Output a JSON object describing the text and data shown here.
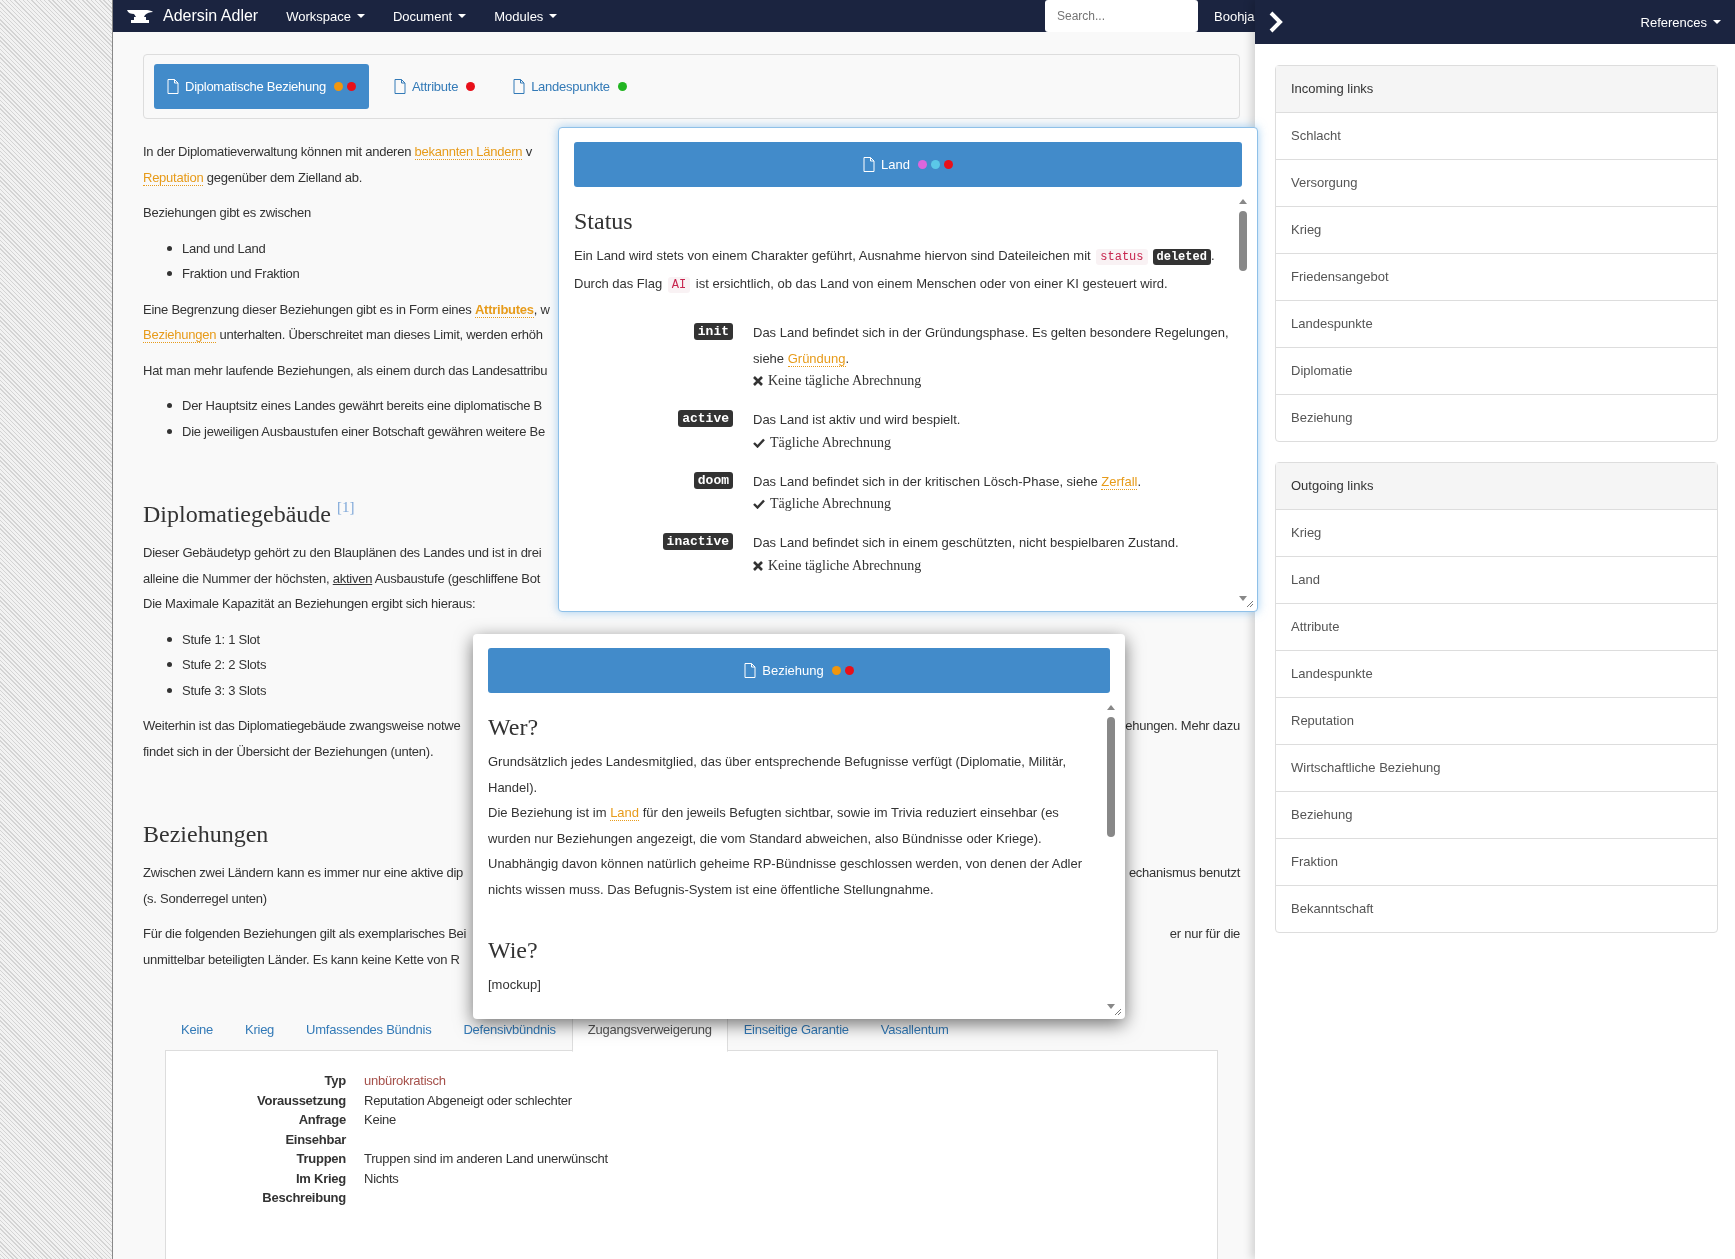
{
  "navbar": {
    "brand": "Adersin Adler",
    "menus": [
      "Workspace",
      "Document",
      "Modules"
    ],
    "search": {
      "placeholder": "Search..."
    },
    "user": "Boohja"
  },
  "doc_tabs": [
    {
      "label": "Diplomatische Beziehung",
      "selected": true,
      "dots": [
        {
          "color": "#f0960e"
        },
        {
          "color": "#e8101a"
        }
      ]
    },
    {
      "label": "Attribute",
      "selected": false,
      "dots": [
        {
          "color": "#e8101a"
        }
      ]
    },
    {
      "label": "Landespunkte",
      "selected": false,
      "dots": [
        {
          "color": "#22b522"
        }
      ]
    }
  ],
  "content": [
    {
      "kind": "paragraph",
      "lines": [
        {
          "segments": [
            {
              "kind": "plain",
              "text": "In der Diplomatieverwaltung können mit anderen "
            },
            {
              "kind": "link",
              "text": "bekannten Ländern"
            },
            {
              "kind": "plain",
              "text": " v"
            }
          ]
        },
        {
          "segments": [
            {
              "kind": "link",
              "text": "Reputation"
            },
            {
              "kind": "plain",
              "text": " gegenüber dem Zielland ab."
            }
          ]
        }
      ]
    },
    {
      "kind": "paragraph",
      "lines": [
        {
          "segments": [
            {
              "kind": "plain",
              "text": "Beziehungen gibt es zwischen"
            }
          ]
        }
      ]
    },
    {
      "kind": "list",
      "items": [
        {
          "segments": [
            {
              "kind": "plain",
              "text": "Land und Land"
            }
          ]
        },
        {
          "segments": [
            {
              "kind": "plain",
              "text": "Fraktion und Fraktion"
            }
          ]
        }
      ]
    },
    {
      "kind": "paragraph",
      "lines": [
        {
          "segments": [
            {
              "kind": "plain",
              "text": "Eine Begrenzung dieser Beziehungen gibt es in Form eines "
            },
            {
              "kind": "strong-link",
              "text": "Attributes"
            },
            {
              "kind": "plain",
              "text": ", w"
            }
          ]
        },
        {
          "segments": [
            {
              "kind": "link",
              "text": "Beziehungen"
            },
            {
              "kind": "plain",
              "text": " unterhalten. Überschreitet man dieses Limit, werden erhöh"
            }
          ]
        }
      ]
    },
    {
      "kind": "paragraph",
      "lines": [
        {
          "segments": [
            {
              "kind": "plain",
              "text": "Hat man mehr laufende Beziehungen, als einem durch das Landesattribu"
            }
          ]
        }
      ]
    },
    {
      "kind": "list",
      "items": [
        {
          "segments": [
            {
              "kind": "plain",
              "text": "Der Hauptsitz eines Landes gewährt bereits eine diplomatische B"
            }
          ]
        },
        {
          "segments": [
            {
              "kind": "plain",
              "text": "Die jeweiligen Ausbaustufen einer Botschaft gewähren weitere Be"
            }
          ]
        }
      ]
    },
    {
      "kind": "heading",
      "text": "Diplomatiegebäude",
      "note": "[1]"
    },
    {
      "kind": "paragraph",
      "lines": [
        {
          "segments": [
            {
              "kind": "plain",
              "text": "Dieser Gebäudetyp gehört zu den Blauplänen des Landes und ist in drei"
            }
          ]
        },
        {
          "segments": [
            {
              "kind": "plain",
              "text": "alleine die Nummer der höchsten, "
            },
            {
              "kind": "underlined",
              "text": "aktiven"
            },
            {
              "kind": "plain",
              "text": " Ausbaustufe (geschliffene Bot"
            }
          ]
        },
        {
          "segments": [
            {
              "kind": "plain",
              "text": "Die Maximale Kapazität an Beziehungen ergibt sich hieraus:"
            }
          ]
        }
      ]
    },
    {
      "kind": "list",
      "items": [
        {
          "segments": [
            {
              "kind": "plain",
              "text": "Stufe 1: 1 Slot"
            }
          ]
        },
        {
          "segments": [
            {
              "kind": "plain",
              "text": "Stufe 2: 2 Slots"
            }
          ]
        },
        {
          "segments": [
            {
              "kind": "plain",
              "text": "Stufe 3: 3 Slots"
            }
          ]
        }
      ]
    },
    {
      "kind": "paragraph",
      "lines": [
        {
          "segments": [
            {
              "kind": "plain",
              "text": "Weiterhin ist das Diplomatiegebäude zwangsweise notwe"
            }
          ],
          "tail": "ehungen. Mehr dazu"
        },
        {
          "segments": [
            {
              "kind": "plain",
              "text": "findet sich in der Übersicht der Beziehungen (unten)."
            }
          ]
        }
      ]
    },
    {
      "kind": "heading",
      "text": "Beziehungen"
    },
    {
      "kind": "paragraph",
      "lines": [
        {
          "segments": [
            {
              "kind": "plain",
              "text": "Zwischen zwei Ländern kann es immer nur eine aktive dip"
            }
          ],
          "tail": "echanismus benutzt"
        },
        {
          "segments": [
            {
              "kind": "plain",
              "text": "(s. Sonderregel unten)"
            }
          ]
        }
      ]
    },
    {
      "kind": "paragraph",
      "lines": [
        {
          "segments": [
            {
              "kind": "plain",
              "text": "Für die folgenden Beziehungen gilt als exemplarisches Bei"
            }
          ],
          "tail": "er nur für die"
        },
        {
          "segments": [
            {
              "kind": "plain",
              "text": "unmittelbar beteiligten Länder. Es kann keine Kette von R"
            }
          ]
        }
      ]
    }
  ],
  "relation_tabs": [
    {
      "label": "Keine",
      "selected": false
    },
    {
      "label": "Krieg",
      "selected": false
    },
    {
      "label": "Umfassendes Bündnis",
      "selected": false
    },
    {
      "label": "Defensivbündnis",
      "selected": false
    },
    {
      "label": "Zugangsverweigerung",
      "selected": true
    },
    {
      "label": "Einseitige Garantie",
      "selected": false
    },
    {
      "label": "Vasallentum",
      "selected": false
    }
  ],
  "details": [
    {
      "label": "Typ",
      "value": "unbürokratisch",
      "kind": "type"
    },
    {
      "label": "Voraussetzung",
      "value": "Reputation Abgeneigt oder schlechter",
      "kind": "plain"
    },
    {
      "label": "Anfrage",
      "value": "Keine",
      "kind": "plain"
    },
    {
      "label": "Einsehbar"
    },
    {
      "label": "Truppen",
      "value": "Truppen sind im anderen Land unerwünscht",
      "kind": "plain"
    },
    {
      "label": "Im Krieg",
      "value": "Nichts",
      "kind": "plain"
    },
    {
      "label": "Beschreibung"
    }
  ],
  "references": {
    "title": "References",
    "panels": [
      {
        "title": "Incoming links",
        "items": [
          "Schlacht",
          "Versorgung",
          "Krieg",
          "Friedensangebot",
          "Landespunkte",
          "Diplomatie",
          "Beziehung"
        ]
      },
      {
        "title": "Outgoing links",
        "items": [
          "Krieg",
          "Land",
          "Attribute",
          "Landespunkte",
          "Reputation",
          "Wirtschaftliche Beziehung",
          "Beziehung",
          "Fraktion",
          "Bekanntschaft"
        ]
      }
    ]
  },
  "popups": [
    {
      "title": "Land",
      "dots": [
        {
          "color": "#dd66dd"
        },
        {
          "color": "#5bc8e8"
        },
        {
          "color": "#e8101a"
        }
      ],
      "body": [
        {
          "kind": "heading",
          "text": "Status"
        },
        {
          "kind": "paragraph",
          "lines": [
            {
              "segments": [
                {
                  "kind": "plain",
                  "text": "Ein Land wird stets von einem Charakter geführt, Ausnahme hiervon sind Dateileichen mit "
                },
                {
                  "kind": "code",
                  "text": "status"
                },
                {
                  "kind": "kbd",
                  "text": "deleted"
                },
                {
                  "kind": "plain",
                  "text": "."
                }
              ]
            },
            {
              "segments": [
                {
                  "kind": "plain",
                  "text": "Durch das Flag "
                },
                {
                  "kind": "code",
                  "text": "AI"
                },
                {
                  "kind": "plain",
                  "text": " ist ersichtlich, ob das Land von einem Menschen oder von einer KI gesteuert wird."
                }
              ]
            }
          ]
        },
        {
          "kind": "states",
          "items": [
            {
              "badge": "init",
              "segments": [
                {
                  "kind": "plain",
                  "text": "Das Land befindet sich in der Gründungsphase. Es gelten besondere Regelungen, siehe "
                },
                {
                  "kind": "link",
                  "text": "Gründung"
                },
                {
                  "kind": "plain",
                  "text": "."
                }
              ],
              "daily": false,
              "billing": "Keine tägliche Abrechnung"
            },
            {
              "badge": "active",
              "segments": [
                {
                  "kind": "plain",
                  "text": "Das Land ist aktiv und wird bespielt."
                }
              ],
              "daily": true,
              "billing": "Tägliche Abrechnung"
            },
            {
              "badge": "doom",
              "segments": [
                {
                  "kind": "plain",
                  "text": "Das Land befindet sich in der kritischen Lösch-Phase, siehe "
                },
                {
                  "kind": "link",
                  "text": "Zerfall"
                },
                {
                  "kind": "plain",
                  "text": "."
                }
              ],
              "daily": true,
              "billing": "Tägliche Abrechnung"
            },
            {
              "badge": "inactive",
              "segments": [
                {
                  "kind": "plain",
                  "text": "Das Land befindet sich in einem geschützten, nicht bespielbaren Zustand."
                }
              ],
              "daily": false,
              "billing": "Keine tägliche Abrechnung"
            }
          ]
        }
      ]
    },
    {
      "title": "Beziehung",
      "dots": [
        {
          "color": "#f0960e"
        },
        {
          "color": "#e8101a"
        }
      ],
      "body": [
        {
          "kind": "heading",
          "text": "Wer?"
        },
        {
          "kind": "paragraph",
          "lines": [
            {
              "segments": [
                {
                  "kind": "plain",
                  "text": "Grundsätzlich jedes Landesmitglied, das über entsprechende Befugnisse verfügt (Diplomatie, Militär, Handel)."
                }
              ]
            },
            {
              "segments": [
                {
                  "kind": "plain",
                  "text": "Die Beziehung ist im "
                },
                {
                  "kind": "link",
                  "text": "Land"
                },
                {
                  "kind": "plain",
                  "text": " für den jeweils Befugten sichtbar, sowie im Trivia reduziert einsehbar (es wurden nur Beziehungen angezeigt, die vom Standard abweichen, also Bündnisse oder Kriege)."
                }
              ]
            },
            {
              "segments": [
                {
                  "kind": "plain",
                  "text": "Unabhängig davon können natürlich geheime RP-Bündnisse geschlossen werden, von denen der Adler nichts wissen muss. Das Befugnis-System ist eine öffentliche Stellungnahme."
                }
              ]
            }
          ]
        },
        {
          "kind": "heading",
          "text": "Wie?"
        },
        {
          "kind": "paragraph",
          "lines": [
            {
              "segments": [
                {
                  "kind": "plain",
                  "text": "[mockup]"
                }
              ]
            }
          ]
        }
      ]
    }
  ]
}
